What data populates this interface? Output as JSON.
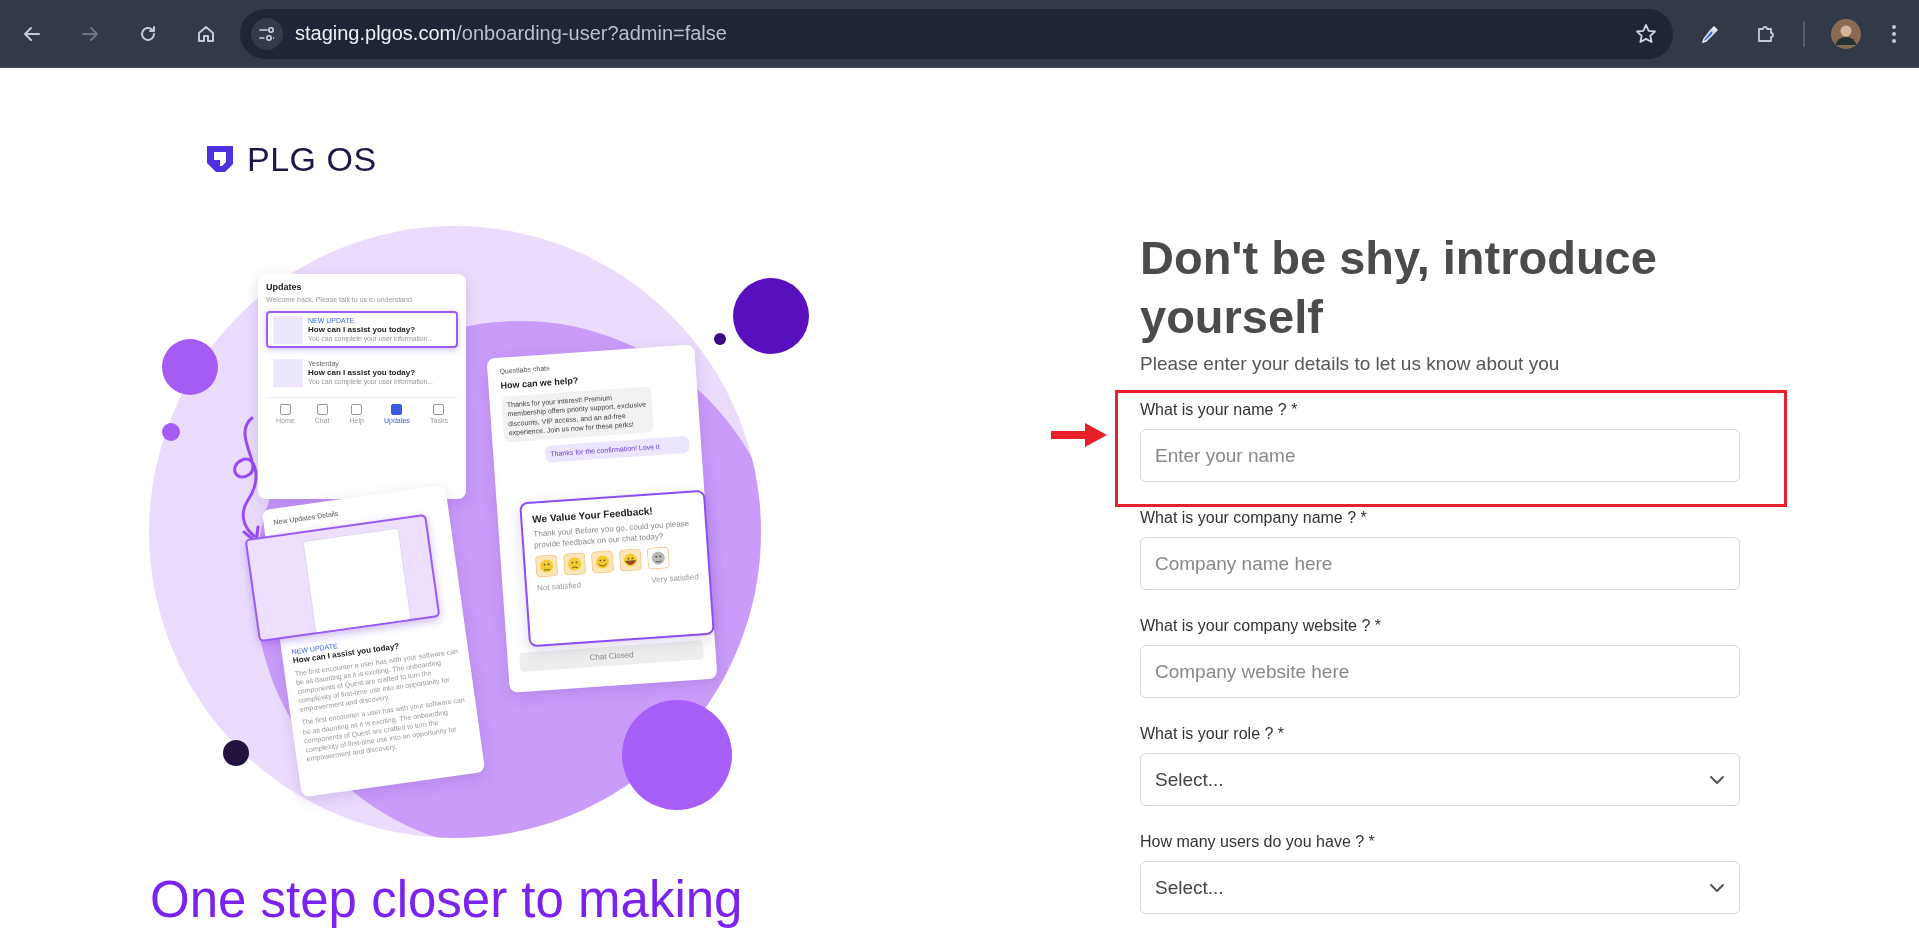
{
  "browser": {
    "url_host": "staging.plgos.com",
    "url_path": "/onboarding-user?admin=false"
  },
  "logo": {
    "text": "PLG OS"
  },
  "illustration": {
    "updates_card": {
      "title": "Updates",
      "subtitle": "Welcome back, Please talk to us to understand",
      "items": [
        {
          "tag": "NEW UPDATE",
          "title": "How can I assist you today?",
          "desc": "You can complete your user information...",
          "highlighted": true
        },
        {
          "tag": "Yesterday",
          "title": "How can I assist you today?",
          "desc": "You can complete your user information...",
          "highlighted": false
        }
      ],
      "nav": [
        {
          "label": "Home",
          "selected": false
        },
        {
          "label": "Chat",
          "selected": false
        },
        {
          "label": "Help",
          "selected": false
        },
        {
          "label": "Updates",
          "selected": true
        },
        {
          "label": "Tasks",
          "selected": false
        }
      ]
    },
    "chat_card": {
      "title": "Questlabs chats",
      "heading": "How can we help?",
      "messages": [
        {
          "kind": "agent",
          "text": "Thanks for your interest! Premium membership offers priority support, exclusive discounts, VIP access, and an ad-free experience. Join us now for these perks!"
        },
        {
          "kind": "user",
          "text": "Thanks for the confirmation! Love it"
        }
      ],
      "footer": "Chat Closed"
    },
    "feedback_card": {
      "title": "We Value Your Feedback!",
      "text": "Thank you! Before you go, could you please provide feedback on our chat today?",
      "low_label": "Not satisfied",
      "high_label": "Very satisfied"
    },
    "details_card": {
      "title": "New Updates Details",
      "tag": "NEW UPDATE",
      "heading": "How can I assist you today?",
      "paragraphs": [
        "The first encounter a user has with your software can be as daunting as it is exciting. The onboarding components of Quest are crafted to turn the complexity of first-time use into an opportunity for empowerment and discovery.",
        "The first encounter a user has with your software can be as daunting as it is exciting. The onboarding components of Quest are crafted to turn the complexity of first-time use into an opportunity for empowerment and discovery."
      ]
    }
  },
  "tagline": "One step closer to making",
  "form": {
    "heading": "Don't be shy, introduce yourself",
    "subtitle": "Please enter your details to let us know about you",
    "fields": [
      {
        "kind": "text",
        "label": "What is your name ? *",
        "placeholder": "Enter your name",
        "highlighted": true
      },
      {
        "kind": "text",
        "label": "What is your company name ? *",
        "placeholder": "Company name here",
        "highlighted": false
      },
      {
        "kind": "text",
        "label": "What is your company website ? *",
        "placeholder": "Company website here",
        "highlighted": false
      },
      {
        "kind": "select",
        "label": "What is your role ? *",
        "value": "Select...",
        "highlighted": false
      },
      {
        "kind": "select",
        "label": "How many users do you have ? *",
        "value": "Select...",
        "highlighted": false
      }
    ]
  }
}
